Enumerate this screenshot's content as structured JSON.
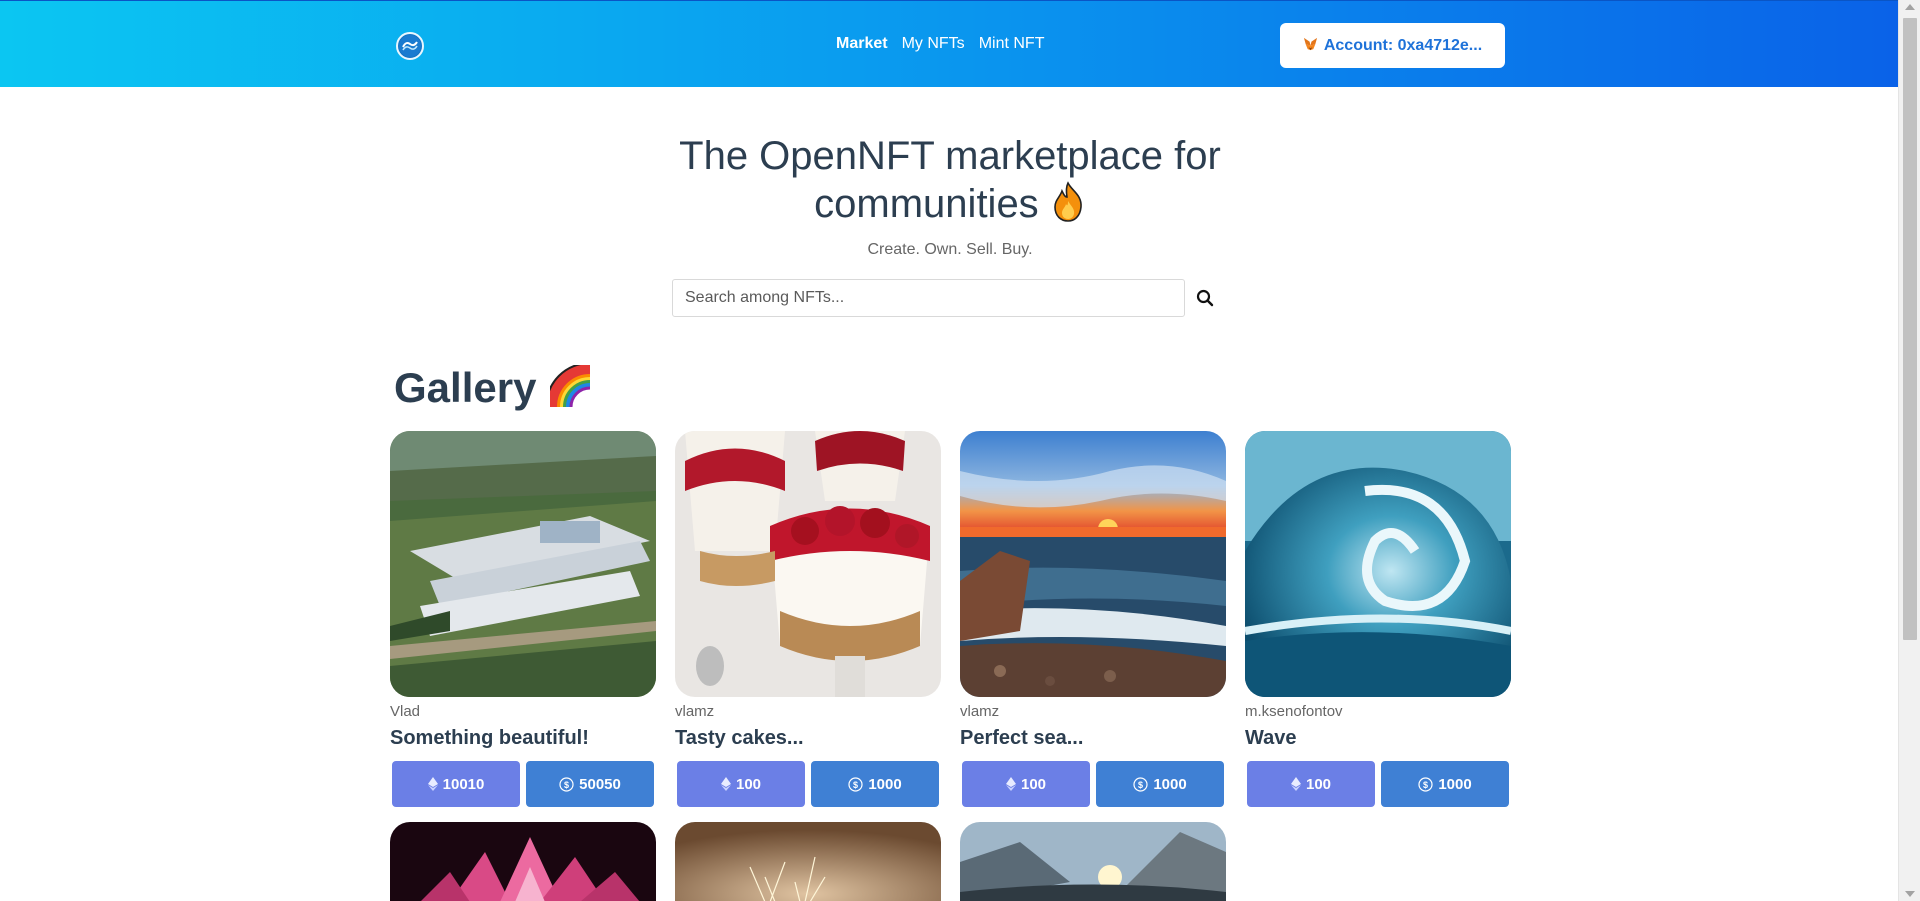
{
  "header": {
    "logo_icon": "openNFT-logo-icon",
    "nav": [
      {
        "label": "Market",
        "active": true
      },
      {
        "label": "My NFTs",
        "active": false
      },
      {
        "label": "Mint NFT",
        "active": false
      }
    ],
    "account_button": {
      "icon": "metamask-fox-icon",
      "label": "Account: 0xa4712e..."
    },
    "gradient_colors": [
      "#0bc6f2",
      "#0a62e8"
    ]
  },
  "hero": {
    "title_line1": "The OpenNFT marketplace for",
    "title_line2": "communities",
    "title_emoji": "fire-emoji",
    "tagline": "Create. Own. Sell. Buy."
  },
  "search": {
    "placeholder": "Search among NFTs...",
    "value": "",
    "icon": "search-icon"
  },
  "gallery": {
    "title": "Gallery",
    "title_emoji": "rainbow-emoji",
    "cards": [
      {
        "owner": "Vlad",
        "name": "Something beautiful!",
        "eth_price": "10010",
        "usd_price": "50050",
        "image": "aerial-facility-forest"
      },
      {
        "owner": "vlamz",
        "name": "Tasty cakes...",
        "eth_price": "100",
        "usd_price": "1000",
        "image": "cherry-cheesecake-cups"
      },
      {
        "owner": "vlamz",
        "name": "Perfect sea...",
        "eth_price": "100",
        "usd_price": "1000",
        "image": "sunset-sea-shore"
      },
      {
        "owner": "m.ksenofontov",
        "name": "Wave",
        "eth_price": "100",
        "usd_price": "1000",
        "image": "ocean-wave"
      }
    ],
    "partial_cards": [
      {
        "image": "pink-lotus-flower"
      },
      {
        "image": "sparkler-bokeh"
      },
      {
        "image": "mountain-sunrise"
      }
    ]
  },
  "colors": {
    "eth_button": "#6b7fe6",
    "usd_button": "#3f80d4",
    "accent": "#1e72d9"
  }
}
